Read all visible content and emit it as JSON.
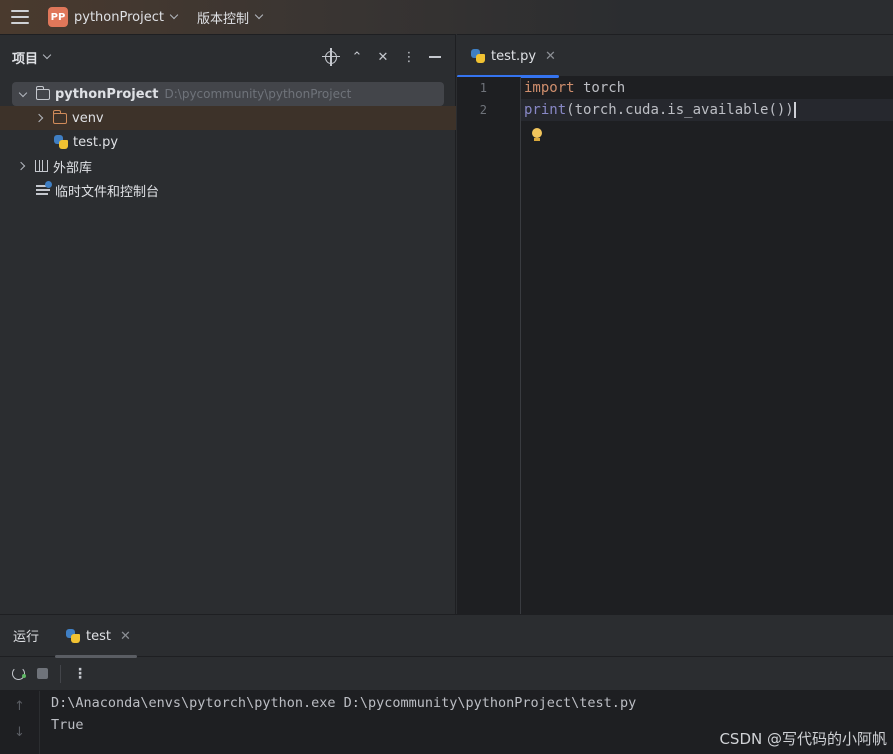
{
  "titlebar": {
    "project_badge": "PP",
    "project_name": "pythonProject",
    "vcs_label": "版本控制"
  },
  "project_panel": {
    "title": "项目",
    "tree": [
      {
        "label": "pythonProject",
        "hint": "D:\\pycommunity\\pythonProject"
      },
      {
        "label": "venv"
      },
      {
        "label": "test.py"
      },
      {
        "label": "外部库"
      },
      {
        "label": "临时文件和控制台"
      }
    ]
  },
  "editor": {
    "tab_label": "test.py",
    "line_numbers": [
      "1",
      "2"
    ],
    "lines": [
      {
        "kw": "import",
        "rest": " torch"
      },
      {
        "fn": "print",
        "rest": "(torch.cuda.is_available())"
      }
    ]
  },
  "run_panel": {
    "title": "运行",
    "tab_label": "test",
    "output": [
      "D:\\Anaconda\\envs\\pytorch\\python.exe D:\\pycommunity\\pythonProject\\test.py",
      "True"
    ]
  },
  "watermark": "CSDN @写代码的小阿帆",
  "colors": {
    "accent": "#3574f0",
    "badge": "#e0775a",
    "keyword": "#cf8e6d",
    "builtin": "#8888c6"
  }
}
